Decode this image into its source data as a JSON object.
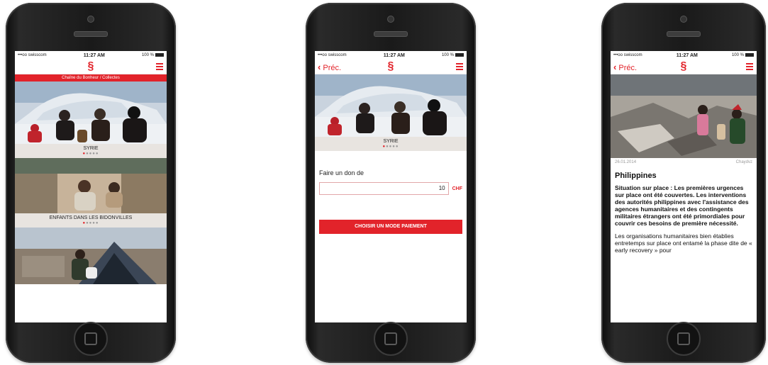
{
  "status_bar": {
    "carrier": "•••oo swisscom",
    "time": "11:27 AM",
    "battery": "100 %"
  },
  "logo_glyph": "§",
  "back_label": "Préc.",
  "phone1": {
    "banner": "Chaîne du Bonheur / Collectes",
    "slides": [
      {
        "caption": "SYRIE"
      },
      {
        "caption": "ENFANTS DANS LES BIDONVILLES"
      }
    ]
  },
  "phone2": {
    "caption": "SYRIE",
    "donate_label": "Faire un don de",
    "amount": "10",
    "currency": "CHF",
    "pay_button": "CHOISIR UN MODE PAIEMENT"
  },
  "phone3": {
    "date": "26.01.2014",
    "share": "Chaydvz",
    "title": "Philippines",
    "lead": "Situation sur place : Les premières urgences sur place ont été couvertes. Les interventions des autorités philippines avec l'assistance des agences humanitaires et des contingents militaires étrangers ont été primordiales pour couvrir ces besoins de première nécessité.",
    "body": "Les organisations humanitaires bien établies entretemps sur place ont entamé la phase dite de « early recovery » pour"
  },
  "colors": {
    "brand": "#e2232a"
  }
}
